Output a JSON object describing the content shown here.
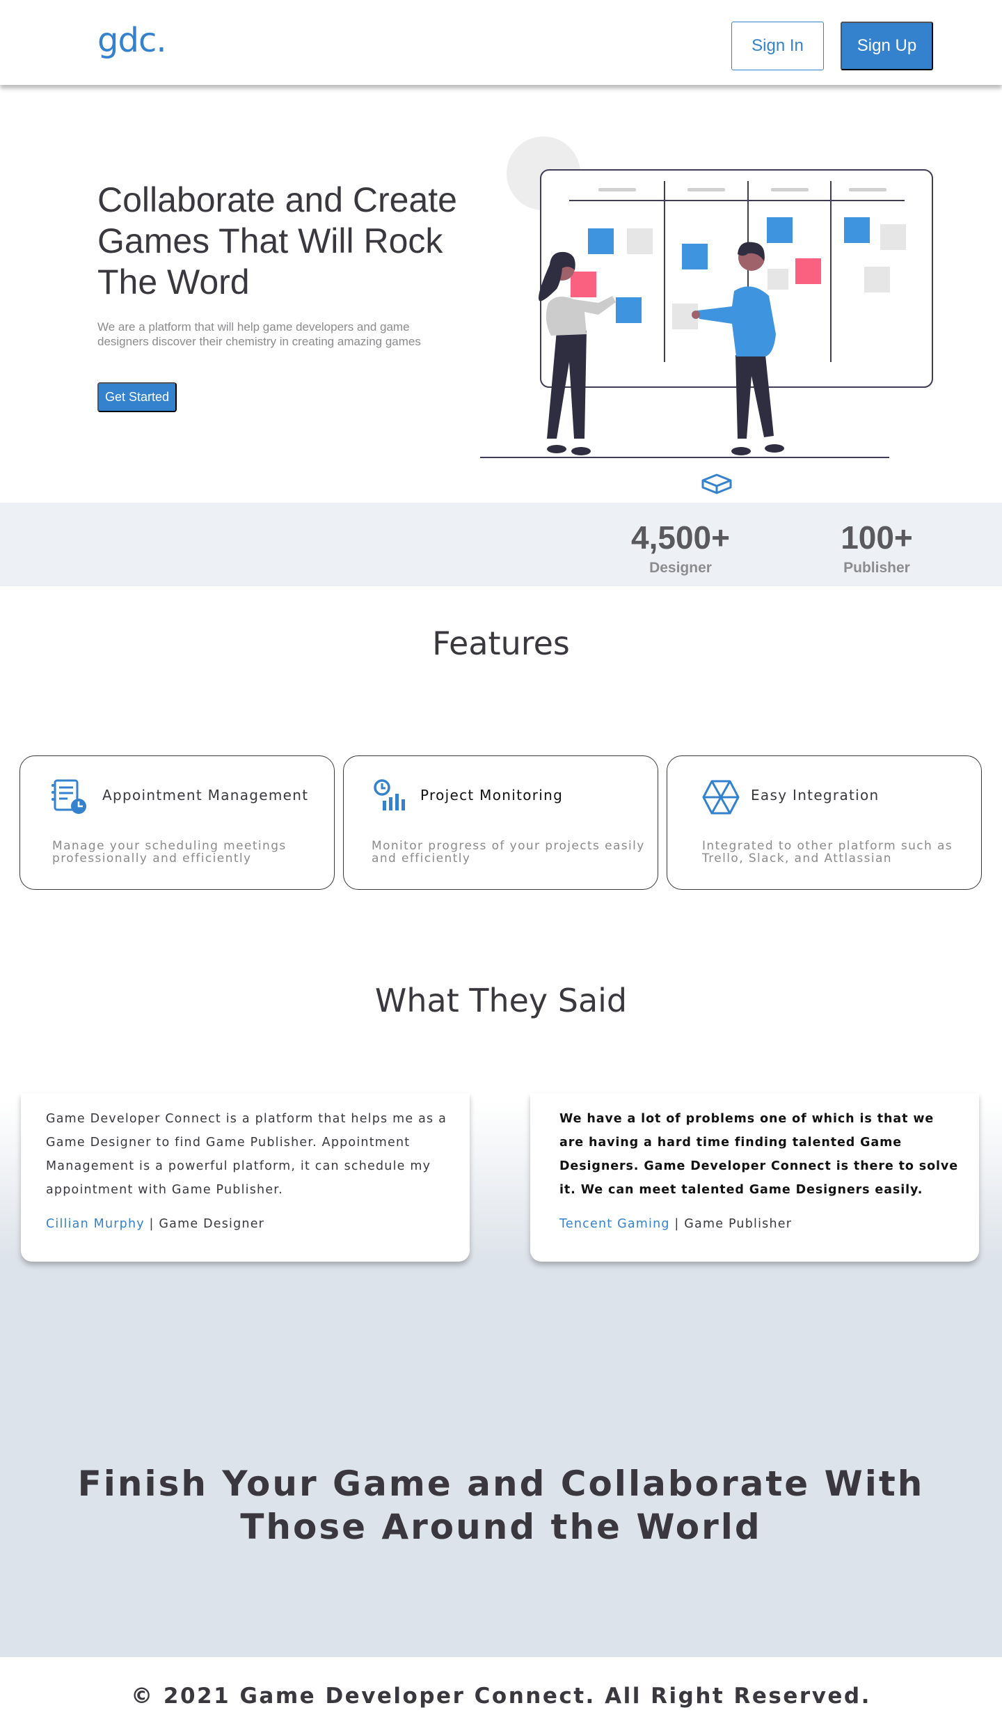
{
  "header": {
    "logo": "gdc.",
    "signin_label": "Sign In",
    "signup_label": "Sign Up"
  },
  "hero": {
    "title": "Collaborate and Create Games That Will Rock The Word",
    "description": "We are a platform that will help game developers and game designers discover their chemistry in creating amazing games",
    "cta_label": "Get Started",
    "illustration_icon": "kanban-board-illustration",
    "scroll_icon": "cube-icon"
  },
  "stats": [
    {
      "value": "4,500+",
      "label": "Designer"
    },
    {
      "value": "100+",
      "label": "Publisher"
    }
  ],
  "features": {
    "title": "Features",
    "items": [
      {
        "icon": "appointment-icon",
        "title": "Appointment Management",
        "description": "Manage your scheduling meetings professionally and efficiently"
      },
      {
        "icon": "monitoring-icon",
        "title": "Project Monitoring",
        "description": "Monitor progress of your projects easily and efficiently"
      },
      {
        "icon": "integration-icon",
        "title": "Easy Integration",
        "description": "Integrated to other platform such as Trello, Slack, and Attlassian"
      }
    ]
  },
  "testimonials": {
    "title": "What They Said",
    "items": [
      {
        "text": "Game Developer Connect is a platform that helps me as a Game Designer to find Game Publisher. Appointment Management is a powerful platform, it can schedule my appointment with Game Publisher.",
        "name": "Cillian Murphy",
        "separator": " | ",
        "role": "Game Designer"
      },
      {
        "text": "We have a lot of problems one of which is that we are having a hard time finding talented Game Designers. Game Developer Connect is there to solve it. We can meet talented Game Designers easily.",
        "name": "Tencent Gaming",
        "separator": " | ",
        "role": "Game Publisher"
      }
    ]
  },
  "cta": {
    "text": "Finish Your Game and Collaborate With Those Around the World"
  },
  "footer": {
    "text": "© 2021 Game Developer Connect. All Right Reserved."
  },
  "colors": {
    "accent": "#3482ce",
    "text": "#3a383e",
    "muted": "#8b8b8d",
    "stats_bg": "#edf1f5",
    "testimonials_bg": "#dde3ea"
  }
}
